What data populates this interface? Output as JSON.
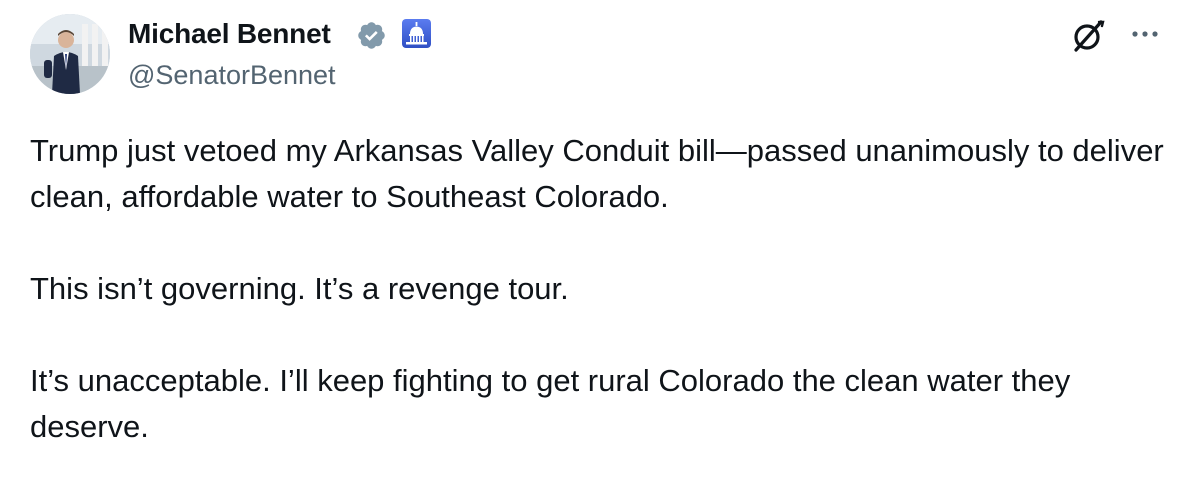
{
  "author": {
    "display_name": "Michael Bennet",
    "handle": "@SenatorBennet",
    "verified_badge": "verified-checkmark-icon",
    "affiliation_badge": "us-capitol-government-icon"
  },
  "actions": {
    "grok_icon": "grok-icon",
    "more_icon": "more-options-icon"
  },
  "tweet": {
    "paragraphs": [
      "Trump just vetoed my Arkansas Valley Conduit bill—passed unanimously to deliver clean, affordable water to Southeast Colorado.",
      "This isn’t governing. It’s a revenge tour.",
      "It’s unacceptable. I’ll keep fighting to get rural Colorado the clean water they deserve."
    ]
  },
  "colors": {
    "text": "#0f1419",
    "secondary_text": "#536471",
    "verified_badge": "#829aab",
    "gov_badge": "#3c5fd9"
  }
}
